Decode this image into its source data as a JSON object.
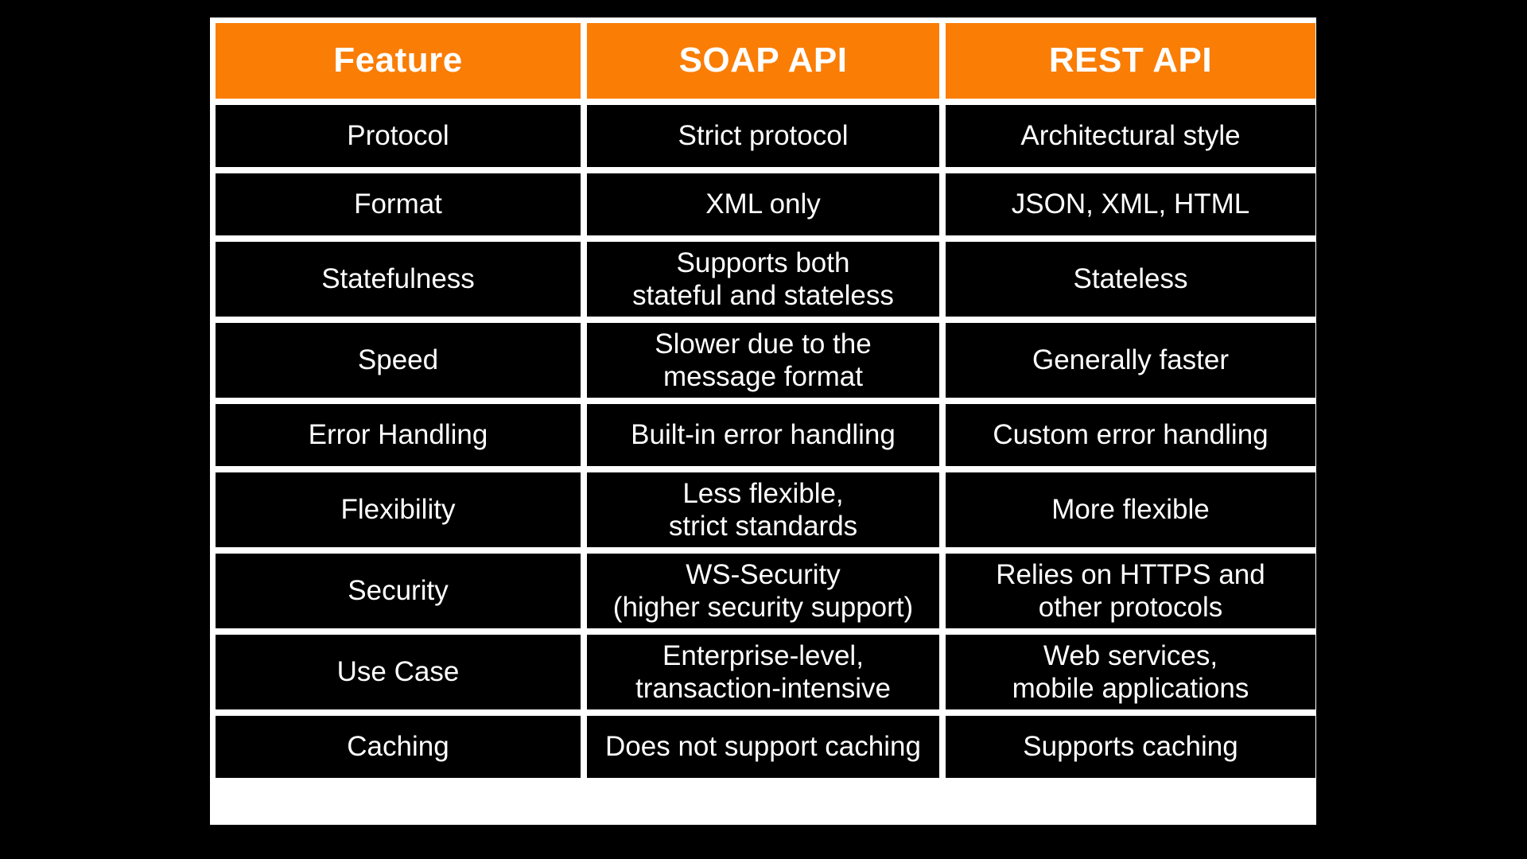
{
  "page": {
    "background_color": "#000000",
    "accent_color": "#fa7d05",
    "grid_color": "#ffffff",
    "text_color": "#ffffff"
  },
  "table": {
    "columns": [
      "Feature",
      "SOAP API",
      "REST API"
    ],
    "rows": [
      {
        "feature": [
          "Protocol"
        ],
        "soap": [
          "Strict protocol"
        ],
        "rest": [
          "Architectural style"
        ]
      },
      {
        "feature": [
          "Format"
        ],
        "soap": [
          "XML only"
        ],
        "rest": [
          "JSON, XML, HTML"
        ]
      },
      {
        "feature": [
          "Statefulness"
        ],
        "soap": [
          "Supports both",
          "stateful and stateless"
        ],
        "rest": [
          "Stateless"
        ]
      },
      {
        "feature": [
          "Speed"
        ],
        "soap": [
          "Slower due to the",
          "message format"
        ],
        "rest": [
          "Generally faster"
        ]
      },
      {
        "feature": [
          "Error Handling"
        ],
        "soap": [
          "Built-in error handling"
        ],
        "rest": [
          "Custom error handling"
        ]
      },
      {
        "feature": [
          "Flexibility"
        ],
        "soap": [
          "Less flexible,",
          "strict standards"
        ],
        "rest": [
          "More flexible"
        ]
      },
      {
        "feature": [
          "Security"
        ],
        "soap": [
          "WS-Security",
          "(higher security support)"
        ],
        "rest": [
          "Relies on HTTPS and",
          "other protocols"
        ]
      },
      {
        "feature": [
          "Use Case"
        ],
        "soap": [
          "Enterprise-level,",
          "transaction-intensive"
        ],
        "rest": [
          "Web services,",
          "mobile applications"
        ]
      },
      {
        "feature": [
          "Caching"
        ],
        "soap": [
          "Does not support caching"
        ],
        "rest": [
          "Supports caching"
        ]
      }
    ]
  }
}
